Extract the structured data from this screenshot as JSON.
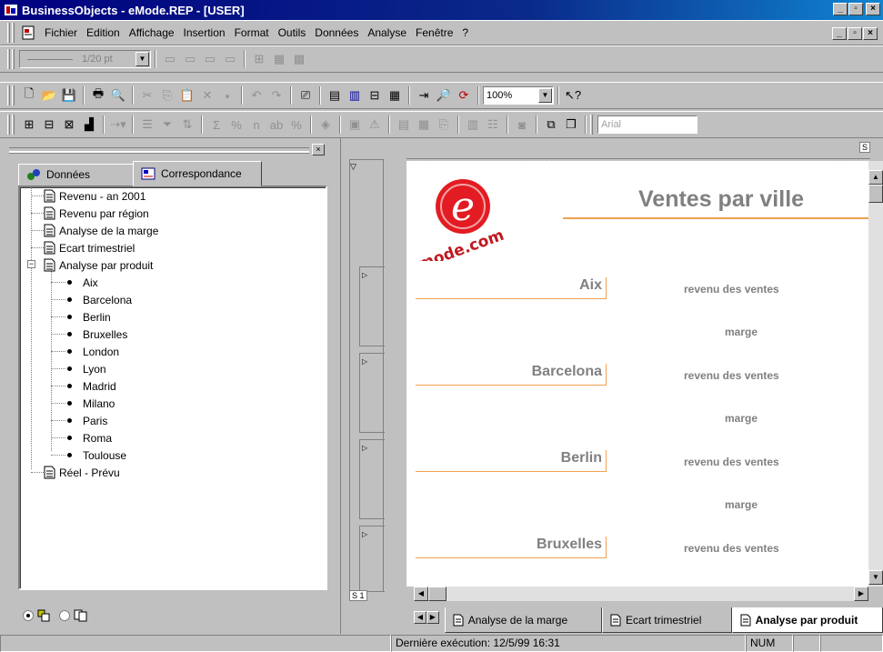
{
  "window": {
    "title": "BusinessObjects - eMode.REP - [USER]",
    "buttons": [
      "_",
      "□",
      "×"
    ]
  },
  "menu": {
    "items": [
      "Fichier",
      "Edition",
      "Affichage",
      "Insertion",
      "Format",
      "Outils",
      "Données",
      "Analyse",
      "Fenêtre",
      "?"
    ]
  },
  "toolbar": {
    "border_size": "1/20 pt",
    "zoom": "100%",
    "font": "Arial"
  },
  "left_panel": {
    "tabs": [
      "Données",
      "Correspondance"
    ],
    "active_tab": "Correspondance",
    "tree": [
      {
        "label": "Revenu - an 2001",
        "type": "doc"
      },
      {
        "label": "Revenu par région",
        "type": "doc"
      },
      {
        "label": "Analyse de la marge",
        "type": "doc"
      },
      {
        "label": "Ecart trimestriel",
        "type": "doc"
      },
      {
        "label": "Analyse par produit",
        "type": "doc",
        "expanded": true
      },
      {
        "label": "Aix",
        "type": "item"
      },
      {
        "label": "Barcelona",
        "type": "item"
      },
      {
        "label": "Berlin",
        "type": "item"
      },
      {
        "label": "Bruxelles",
        "type": "item"
      },
      {
        "label": "London",
        "type": "item"
      },
      {
        "label": "Lyon",
        "type": "item"
      },
      {
        "label": "Madrid",
        "type": "item"
      },
      {
        "label": "Milano",
        "type": "item"
      },
      {
        "label": "Paris",
        "type": "item"
      },
      {
        "label": "Roma",
        "type": "item"
      },
      {
        "label": "Toulouse",
        "type": "item"
      },
      {
        "label": "Réel - Prévu",
        "type": "doc"
      }
    ]
  },
  "strip": {
    "footer": "S 1"
  },
  "report": {
    "title": "Ventes par ville",
    "logo_text": "mode.com",
    "logo_letter": "e",
    "rows": [
      {
        "city": "Aix",
        "label1": "revenu des ventes",
        "label2": "marge"
      },
      {
        "city": "Barcelona",
        "label1": "revenu des ventes",
        "label2": "marge"
      },
      {
        "city": "Berlin",
        "label1": "revenu des ventes",
        "label2": "marge"
      },
      {
        "city": "Bruxelles",
        "label1": "revenu des ventes",
        "label2": ""
      }
    ],
    "corner": "S"
  },
  "sheet_tabs": [
    "Analyse de la marge",
    "Ecart trimestriel",
    "Analyse par produit"
  ],
  "active_sheet": "Analyse par produit",
  "status": {
    "last_run": "Dernière exécution: 12/5/99  16:31",
    "num": "NUM"
  }
}
